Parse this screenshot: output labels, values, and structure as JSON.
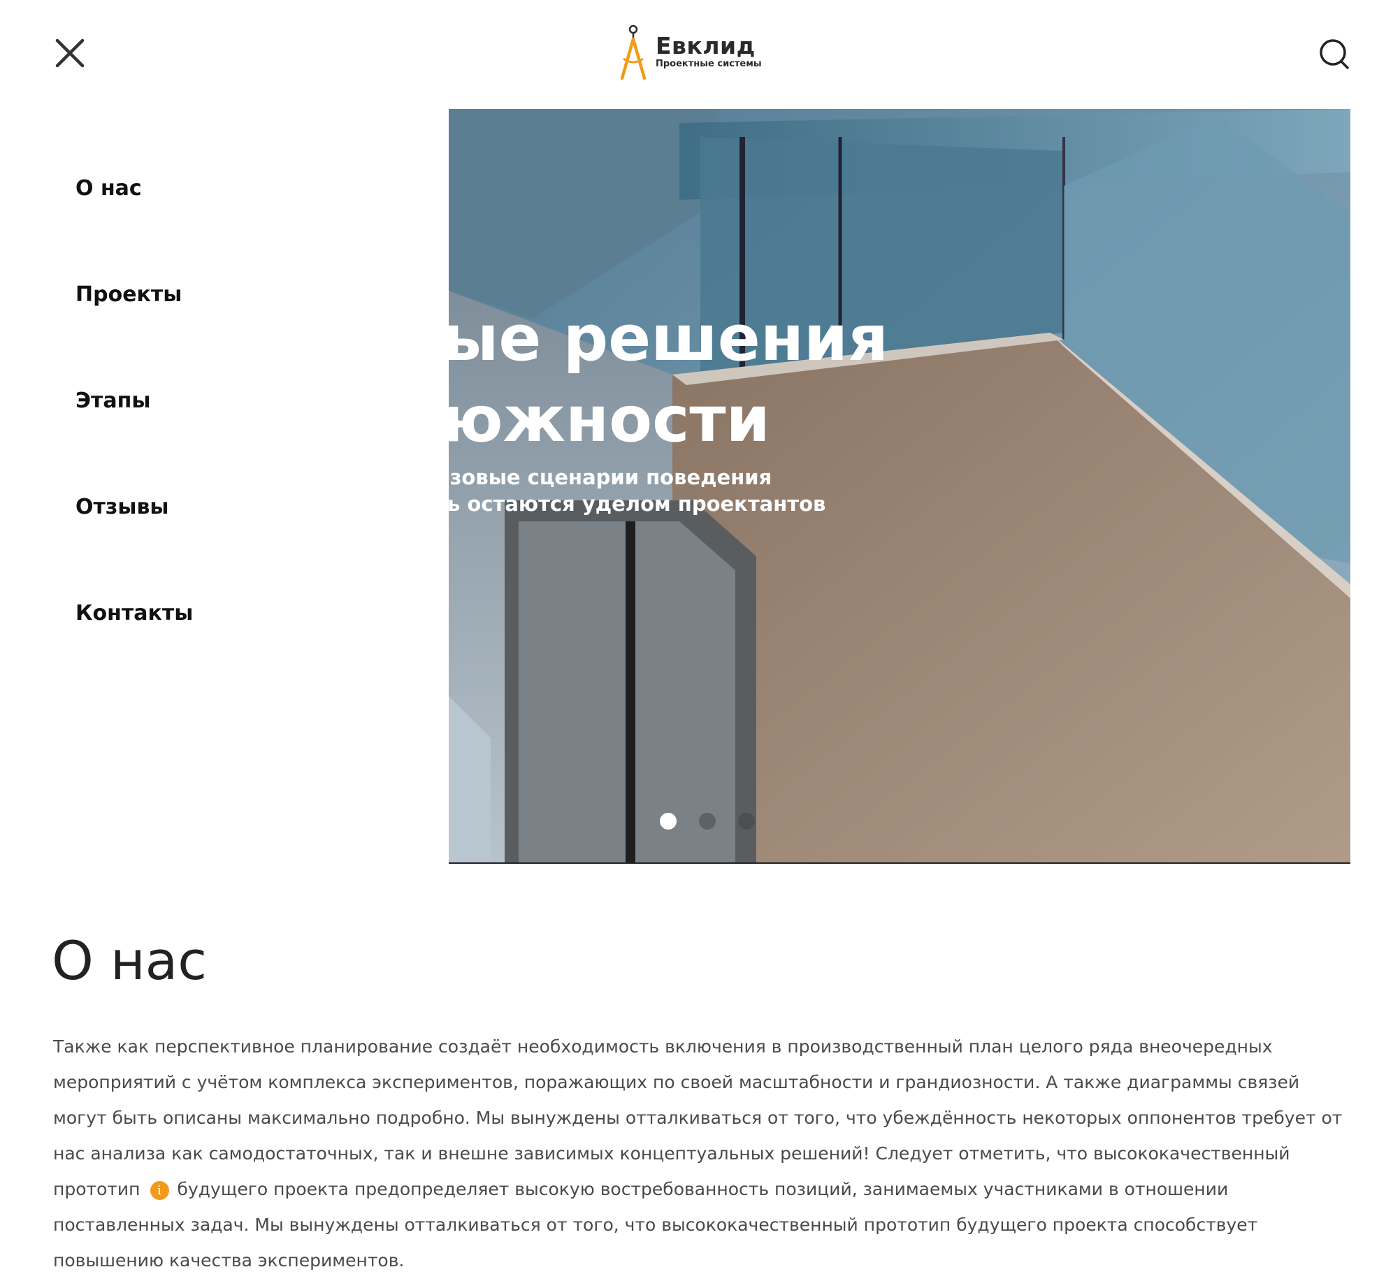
{
  "brand": {
    "name": "Евклид",
    "tagline": "Проектные системы",
    "accent_color": "#f39a1b"
  },
  "header": {
    "close_icon": "close-icon",
    "search_icon": "search-icon"
  },
  "menu": {
    "items": [
      {
        "label": "О нас"
      },
      {
        "label": "Проекты"
      },
      {
        "label": "Этапы"
      },
      {
        "label": "Отзывы"
      },
      {
        "label": "Контакты"
      }
    ]
  },
  "hero": {
    "title_line1": "ые решения",
    "title_line2": "южности",
    "subtitle_line1": "азовые сценарии поведения",
    "subtitle_line2": "ь остаются уделом проектантов",
    "slides_count": 3,
    "active_slide": 1
  },
  "about": {
    "title": "О нас",
    "text_before": "Также как перспективное планирование создаёт необходимость включения в производственный план целого ряда внеочередных мероприятий с учётом комплекса экспериментов, поражающих по своей масштабности и грандиозности. А также диаграммы связей могут быть описаны максимально подробно. Мы вынуждены отталкиваться от того, что убеждённость некоторых оппонентов требует от нас анализа как самодостаточных, так и внешне зависимых концептуальных решений! Следует отметить, что высококачественный прототип",
    "info_symbol": "i",
    "text_after": "будущего проекта предопределяет высокую востребованность позиций, занимаемых участниками в отношении поставленных задач. Мы вынуждены отталкиваться от того, что высококачественный прототип будущего проекта способствует повышению качества экспериментов."
  }
}
